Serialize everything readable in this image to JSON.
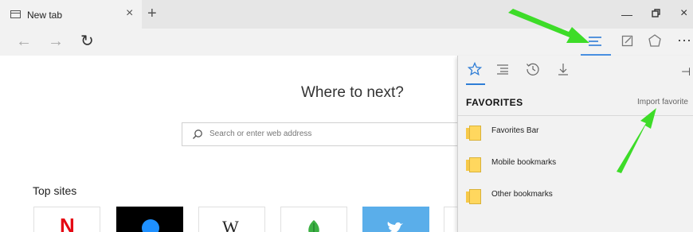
{
  "tab": {
    "title": "New tab",
    "close": "×",
    "new": "+"
  },
  "window": {
    "minimize": "—",
    "restore": "▫",
    "close": "×"
  },
  "nav": {
    "back": "←",
    "forward": "→",
    "refresh": "↻",
    "more": "···"
  },
  "page": {
    "headline": "Where to next?",
    "search_placeholder": "Search or enter web address",
    "top_sites_title": "Top sites",
    "top_sites": [
      "N",
      "",
      "W",
      "",
      "",
      ""
    ]
  },
  "hub": {
    "tabs": [
      "favorites-icon",
      "reading-list-icon",
      "history-icon",
      "downloads-icon"
    ],
    "section_title": "FAVORITES",
    "import_label": "Import favorite",
    "items": [
      "Favorites Bar",
      "Mobile bookmarks",
      "Other bookmarks"
    ]
  },
  "colors": {
    "accent": "#2e7dd6",
    "arrow": "#3ddc28",
    "folder": "#ffd75e"
  }
}
